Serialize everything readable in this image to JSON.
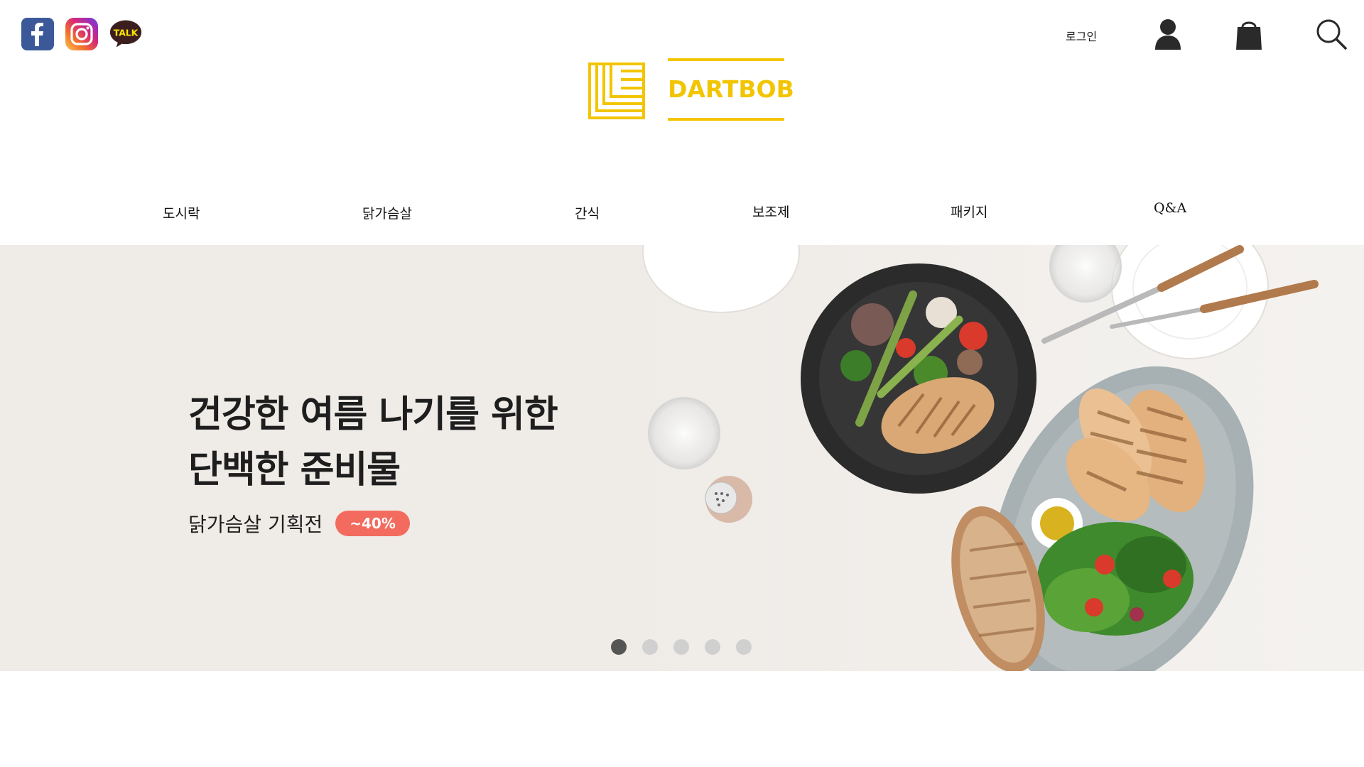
{
  "header": {
    "login_label": "로그인",
    "logo_text": "DARTBOB",
    "social": [
      {
        "icon": "facebook-icon",
        "color": "#3b5998"
      },
      {
        "icon": "instagram-icon",
        "color": "#d62976"
      },
      {
        "icon": "kakaotalk-icon",
        "label": "TALK",
        "color": "#3c1e1e",
        "text_color": "#f7e600"
      }
    ],
    "actions": [
      "user-icon",
      "cart-icon",
      "search-icon"
    ],
    "brand_color": "#f2c500"
  },
  "nav": {
    "items": [
      {
        "label": "도시락"
      },
      {
        "label": "닭가슴살"
      },
      {
        "label": "간식"
      },
      {
        "label": "보조제"
      },
      {
        "label": "패키지"
      },
      {
        "label": "Q&A"
      }
    ]
  },
  "banner": {
    "headline_line1": "건강한 여름 나기를 위한",
    "headline_line2": "단백한 준비물",
    "subtitle": "닭가슴살 기획전",
    "badge": "~40%",
    "badge_color": "#f36b5e",
    "slides_total": 5,
    "active_slide": 1
  }
}
